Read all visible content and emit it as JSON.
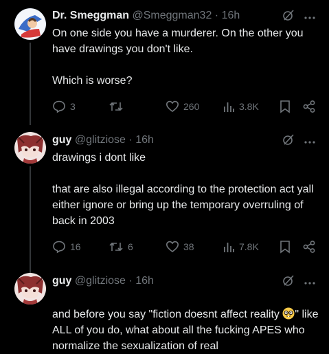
{
  "tweets": [
    {
      "name": "Dr. Smeggman",
      "handle": "@Smeggman32",
      "dot": "·",
      "time": "16h",
      "text": "On one side you have a murderer. On the other you have drawings you don't like.\n\nWhich is worse?",
      "replies": "3",
      "retweets": "",
      "likes": "260",
      "views": "3.8K"
    },
    {
      "name": "guy",
      "handle": "@glitziose",
      "dot": "·",
      "time": "16h",
      "text": "drawings i dont like\n\nthat are also illegal according to the protection act yall either ignore or bring up the temporary overruling of back in 2003",
      "replies": "16",
      "retweets": "6",
      "likes": "38",
      "views": "7.8K"
    },
    {
      "name": "guy",
      "handle": "@glitziose",
      "dot": "·",
      "time": "16h",
      "text_part1": "and before you say \"fiction doesnt affect reality ",
      "text_part2": "\" like ALL of you do, what about all the fucking APES who normalize the sexualization of real"
    }
  ],
  "colors": {
    "background": "#000000",
    "text": "#e7e9ea",
    "muted": "#71767b",
    "divider": "#333639"
  },
  "icons": [
    "reply-icon",
    "retweet-icon",
    "like-icon",
    "views-icon",
    "bookmark-icon",
    "share-icon",
    "grok-icon",
    "more-icon",
    "nerd-emoji"
  ]
}
